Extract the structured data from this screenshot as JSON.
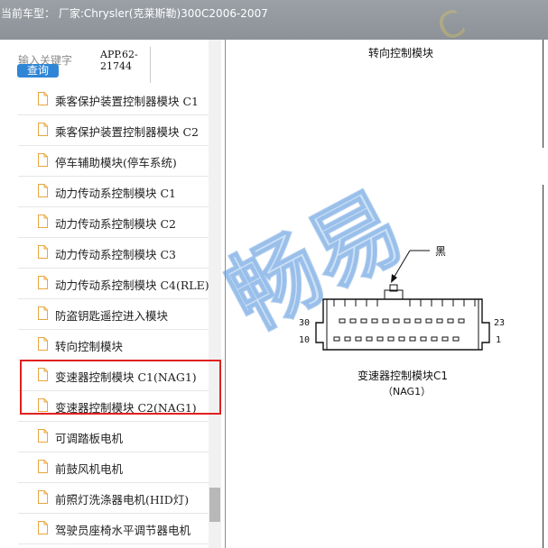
{
  "header": {
    "title": "当前车型：  厂家:Chrysler(克莱斯勒)300C2006-2007"
  },
  "search": {
    "label": "输入关键字",
    "button": "查询",
    "app_code": "APP.62-21744"
  },
  "list": {
    "items": [
      {
        "label": "乘客保护装置控制器模块 C1"
      },
      {
        "label": "乘客保护装置控制器模块 C2"
      },
      {
        "label": "停车辅助模块(停车系统)"
      },
      {
        "label": "动力传动系控制模块 C1"
      },
      {
        "label": "动力传动系控制模块 C2"
      },
      {
        "label": "动力传动系控制模块 C3"
      },
      {
        "label": "动力传动系控制模块 C4(RLE)"
      },
      {
        "label": "防盗钥匙遥控进入模块"
      },
      {
        "label": "转向控制模块"
      },
      {
        "label": "变速器控制模块 C1(NAG1)"
      },
      {
        "label": "变速器控制模块 C2(NAG1)"
      },
      {
        "label": "可调踏板电机"
      },
      {
        "label": "前鼓风机电机"
      },
      {
        "label": "前照灯洗涤器电机(HID灯)"
      },
      {
        "label": "驾驶员座椅水平调节器电机"
      }
    ]
  },
  "document": {
    "top_title": "转向控制模块",
    "connector_color_label": "黑",
    "caption": "变速器控制模块C1",
    "sub_caption": "（NAG1）",
    "pins": {
      "top_left": "30",
      "bottom_left": "10",
      "top_right": "23",
      "bottom_right": "1"
    },
    "watermark": "畅易",
    "watermark_small": "C"
  },
  "colors": {
    "highlight": "#e02020",
    "button": "#2f86d6",
    "titlebar": "#949aa0"
  }
}
